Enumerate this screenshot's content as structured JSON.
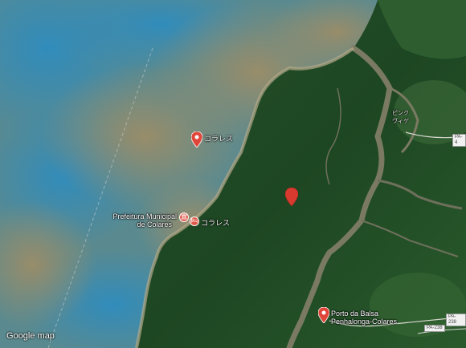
{
  "map": {
    "credit": "Google map",
    "pins": [
      {
        "name": "colares-north",
        "label": "コラレス"
      },
      {
        "name": "unnamed-marker",
        "label": ""
      },
      {
        "name": "porto-da-balsa",
        "label_line1": "Porto da Balsa",
        "label_line2": "Penhalonga-Colares"
      }
    ],
    "pois": [
      {
        "name": "prefeitura",
        "label_line1": "Prefeitura Municipal",
        "label_line2": "de Colares",
        "icon": "government-building-icon"
      },
      {
        "name": "colares-south",
        "label": "コラレス",
        "icon": "bed-icon"
      }
    ],
    "roads": [
      "PA-4",
      "PA-238",
      "PA-238"
    ],
    "place_labels": [
      "ピンク",
      "ヴィゲ"
    ],
    "colors": {
      "water": "#3d7d99",
      "water_sediment": "#8c8368",
      "forest": "#1f4a22",
      "pin": "#e0453a"
    }
  }
}
